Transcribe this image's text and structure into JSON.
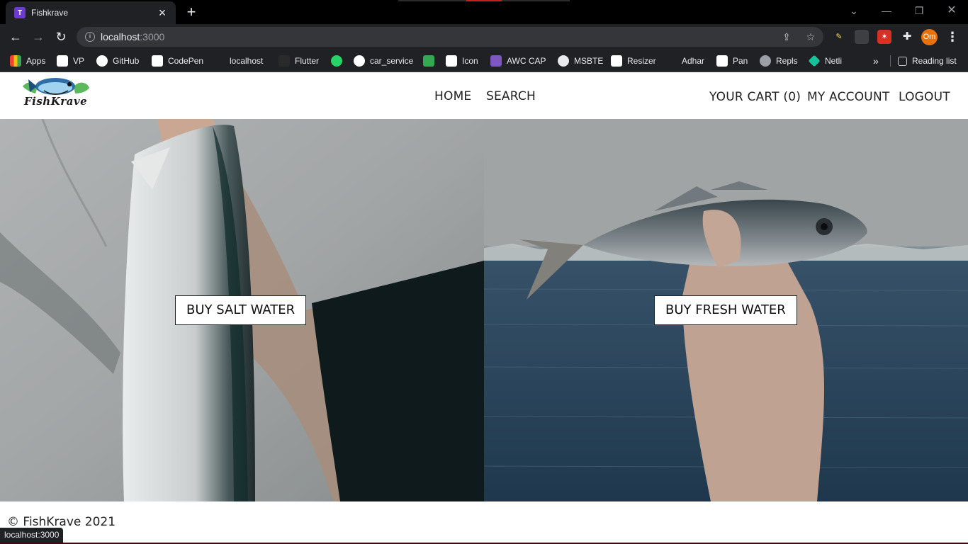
{
  "browser": {
    "tab_title": "Fishkrave",
    "tab_favicon_letter": "T",
    "url_host": "localhost",
    "url_port": ":3000",
    "profile_initials": "Om",
    "status_url": "localhost:3000",
    "bookmarks": [
      {
        "label": "Apps",
        "icon": "apps-grid-icon"
      },
      {
        "label": "VP",
        "icon": "vp-icon"
      },
      {
        "label": "GitHub",
        "icon": "github-icon"
      },
      {
        "label": "CodePen",
        "icon": "codepen-icon"
      },
      {
        "label": "localhost",
        "icon": "localhost-icon"
      },
      {
        "label": "Flutter",
        "icon": "flutter-icon"
      },
      {
        "label": "",
        "icon": "whatsapp-icon"
      },
      {
        "label": "car_service",
        "icon": "github-icon"
      },
      {
        "label": "",
        "icon": "green-app-icon"
      },
      {
        "label": "Icon",
        "icon": "icon-grid-icon"
      },
      {
        "label": "AWC CAP",
        "icon": "awc-icon"
      },
      {
        "label": "MSBTE",
        "icon": "msbte-icon"
      },
      {
        "label": "Resizer",
        "icon": "pdf-icon"
      },
      {
        "label": "Adhar",
        "icon": "adhar-icon"
      },
      {
        "label": "Pan",
        "icon": "nsdl-icon"
      },
      {
        "label": "Repls",
        "icon": "replit-icon"
      },
      {
        "label": "Netli",
        "icon": "netlify-icon"
      }
    ],
    "reading_list_label": "Reading list"
  },
  "site": {
    "logo_text": "FishKrave",
    "nav": {
      "home": "HOME",
      "search": "SEARCH",
      "cart": "YOUR CART (0)",
      "account": "MY ACCOUNT",
      "logout": "LOGOUT"
    },
    "panels": {
      "salt_button": "BUY SALT WATER",
      "fresh_button": "BUY FRESH WATER"
    },
    "footer": "© FishKrave 2021"
  },
  "colors": {
    "chrome_dark": "#202124",
    "tab_strip": "#000000",
    "profile": "#e8710a",
    "favicon": "#6c3bd1"
  }
}
